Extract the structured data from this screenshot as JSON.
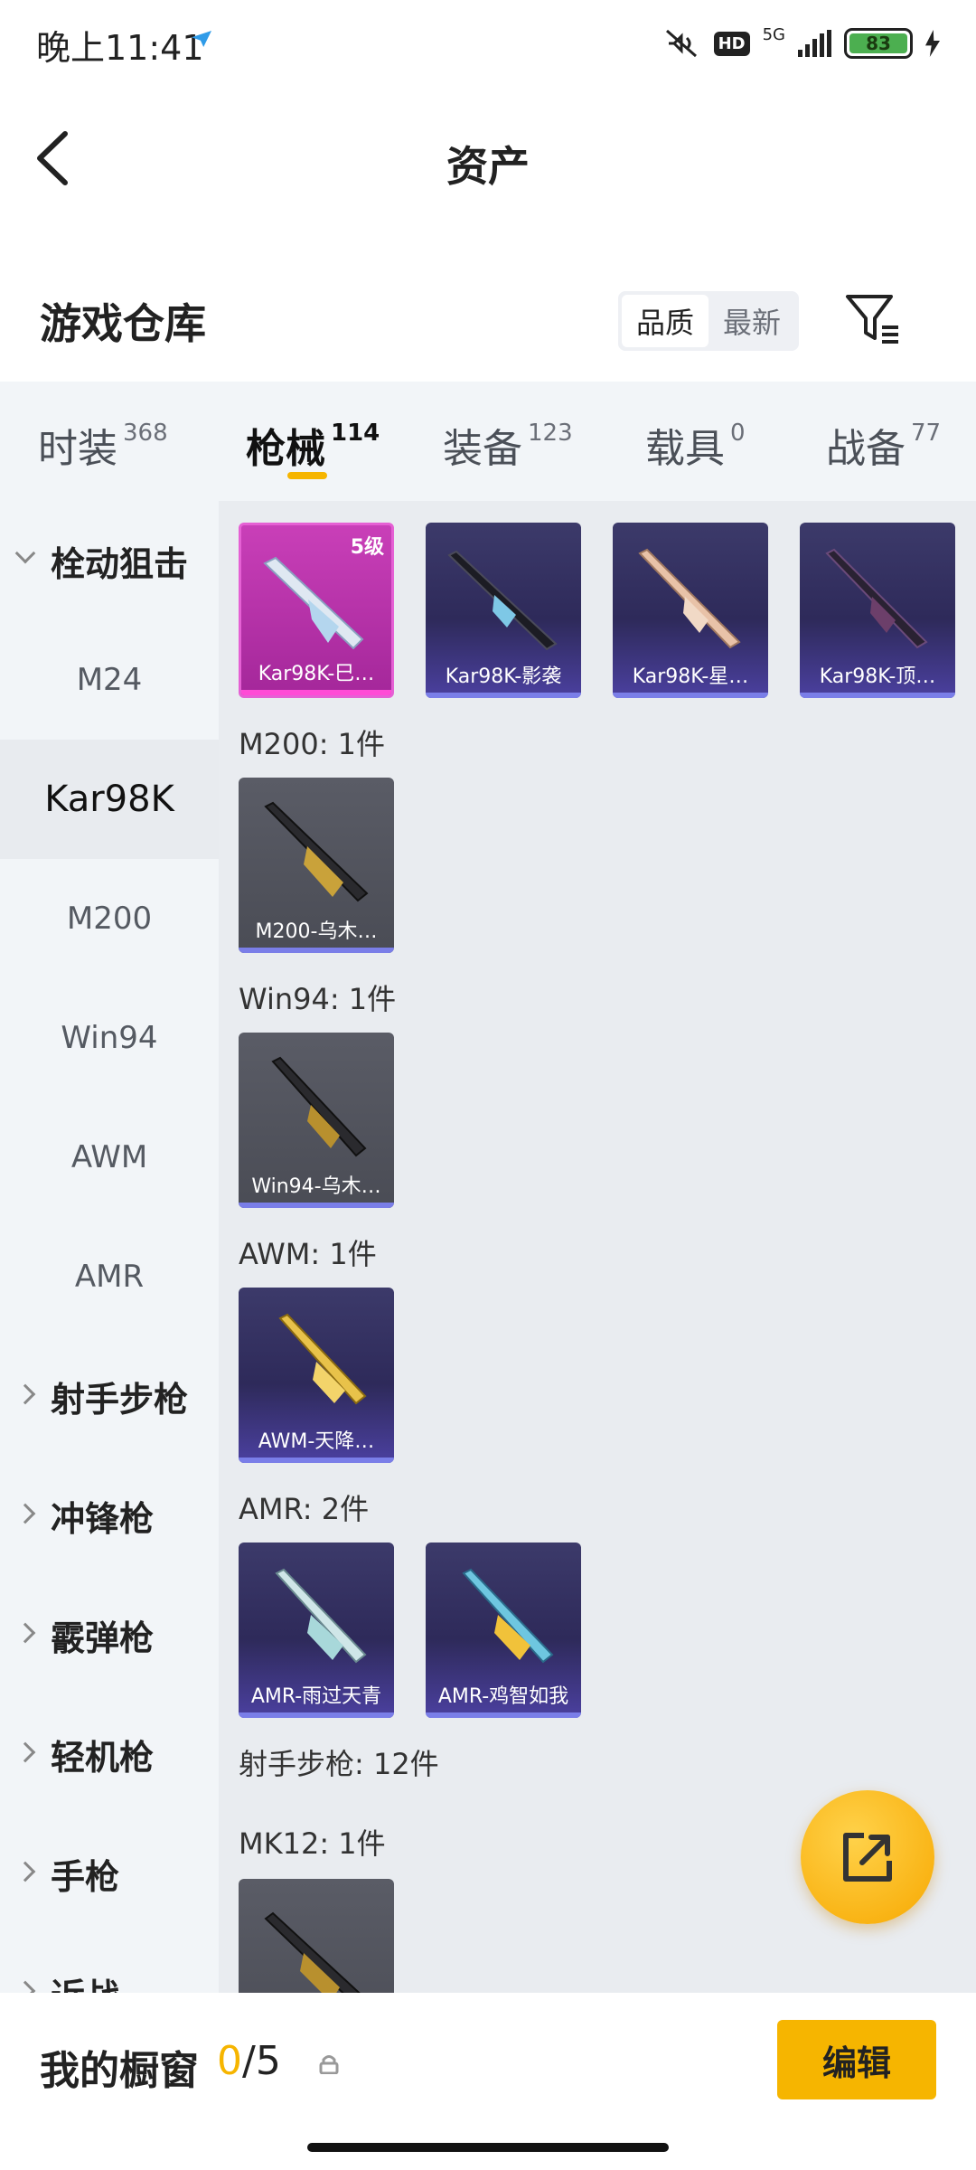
{
  "status_bar": {
    "time": "晚上11:41",
    "network": "5G",
    "hd_badge": "HD",
    "battery": "83"
  },
  "nav": {
    "title": "资产"
  },
  "section": {
    "title": "游戏仓库",
    "sort_options": [
      "品质",
      "最新"
    ],
    "sort_selected": "品质"
  },
  "tabs": [
    {
      "label": "时装",
      "count": "368"
    },
    {
      "label": "枪械",
      "count": "114",
      "active": true
    },
    {
      "label": "装备",
      "count": "123"
    },
    {
      "label": "载具",
      "count": "0"
    },
    {
      "label": "战备",
      "count": "77"
    }
  ],
  "sidebar": {
    "category_open": "栓动狙击",
    "items": [
      "M24",
      "Kar98K",
      "M200",
      "Win94",
      "AWM",
      "AMR"
    ],
    "selected": "Kar98K",
    "categories": [
      "射手步枪",
      "冲锋枪",
      "霰弹枪",
      "轻机枪",
      "手枪",
      "近战"
    ]
  },
  "groups": [
    {
      "title": "",
      "cards": [
        {
          "name": "Kar98K-巳…",
          "level": "5级",
          "rarity": "gold"
        },
        {
          "name": "Kar98K-影袭",
          "rarity": "purple"
        },
        {
          "name": "Kar98K-星…",
          "rarity": "purple"
        },
        {
          "name": "Kar98K-顶…",
          "rarity": "purple"
        }
      ]
    },
    {
      "title": "M200: 1件",
      "cards": [
        {
          "name": "M200-乌木…",
          "rarity": "grey"
        }
      ]
    },
    {
      "title": "Win94: 1件",
      "cards": [
        {
          "name": "Win94-乌木…",
          "rarity": "grey"
        }
      ]
    },
    {
      "title": "AWM: 1件",
      "cards": [
        {
          "name": "AWM-天降…",
          "rarity": "purple"
        }
      ]
    },
    {
      "title": "AMR: 2件",
      "cards": [
        {
          "name": "AMR-雨过天青",
          "rarity": "purple"
        },
        {
          "name": "AMR-鸡智如我",
          "rarity": "purple"
        }
      ]
    }
  ],
  "subsection": {
    "title": "射手步枪: 12件",
    "group_title": "MK12: 1件"
  },
  "bottom": {
    "title": "我的橱窗",
    "current": "0",
    "separator": "/",
    "max": "5",
    "edit_label": "编辑"
  },
  "colors": {
    "accent": "#f6b500",
    "gold_rarity": "#c93fb8",
    "purple_rarity": "#3c3a6a"
  }
}
